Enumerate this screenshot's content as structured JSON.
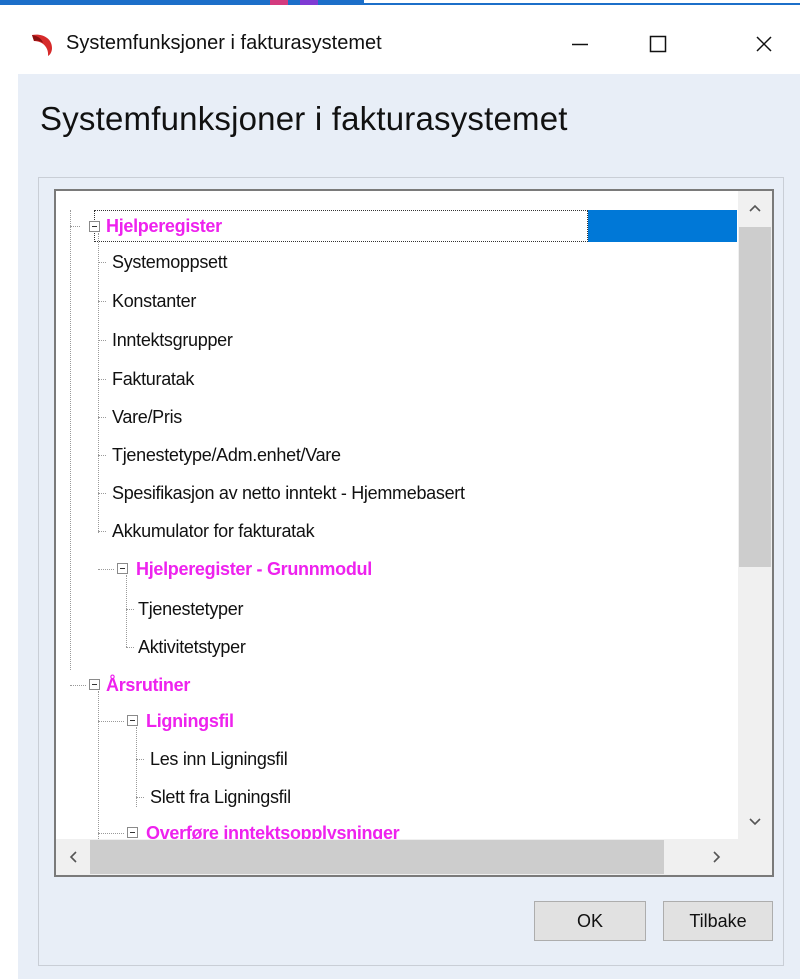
{
  "window": {
    "title": "Systemfunksjoner i fakturasystemet"
  },
  "dialog": {
    "heading": "Systemfunksjoner i fakturasystemet"
  },
  "tree": {
    "items": [
      {
        "label": "Hjelperegister",
        "category": true,
        "expanded": true,
        "selected": true,
        "level": 1
      },
      {
        "label": "Systemoppsett",
        "category": false,
        "level": 2
      },
      {
        "label": "Konstanter",
        "category": false,
        "level": 2
      },
      {
        "label": "Inntektsgrupper",
        "category": false,
        "level": 2
      },
      {
        "label": "Fakturatak",
        "category": false,
        "level": 2
      },
      {
        "label": "Vare/Pris",
        "category": false,
        "level": 2
      },
      {
        "label": "Tjenestetype/Adm.enhet/Vare",
        "category": false,
        "level": 2
      },
      {
        "label": "Spesifikasjon av netto inntekt - Hjemmebasert",
        "category": false,
        "level": 2
      },
      {
        "label": "Akkumulator for fakturatak",
        "category": false,
        "level": 2
      },
      {
        "label": "Hjelperegister - Grunnmodul",
        "category": true,
        "expanded": true,
        "level": 2
      },
      {
        "label": "Tjenestetyper",
        "category": false,
        "level": 3
      },
      {
        "label": "Aktivitetstyper",
        "category": false,
        "level": 3
      },
      {
        "label": "Årsrutiner",
        "category": true,
        "expanded": true,
        "level": 1
      },
      {
        "label": "Ligningsfil",
        "category": true,
        "expanded": true,
        "level": 2
      },
      {
        "label": "Les inn Ligningsfil",
        "category": false,
        "level": 3
      },
      {
        "label": "Slett fra Ligningsfil",
        "category": false,
        "level": 3
      },
      {
        "label": "Overføre inntektsopplysninger",
        "category": true,
        "expanded": true,
        "level": 2
      }
    ]
  },
  "buttons": {
    "ok": "OK",
    "back": "Tilbake"
  },
  "icons": {
    "app": "app-logo-icon",
    "minimize": "minimize-icon",
    "maximize": "maximize-icon",
    "close": "close-icon"
  },
  "colors": {
    "category_text": "#ee22ee",
    "selection": "#0078d7",
    "dialog_background": "#e8eef7"
  }
}
